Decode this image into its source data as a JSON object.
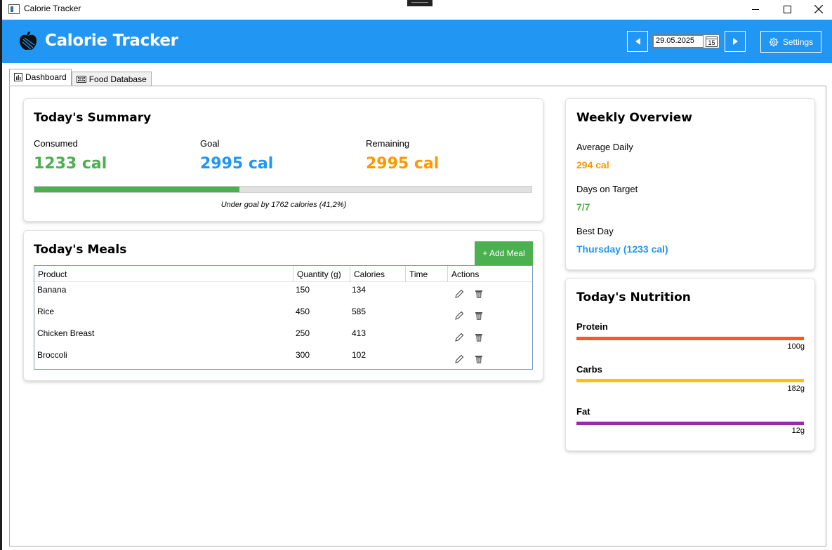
{
  "window": {
    "title": "Calorie Tracker"
  },
  "header": {
    "title": "Calorie Tracker",
    "date": "29.05.2025",
    "calendar_day": "15",
    "settings_label": "Settings",
    "color": "#2196F3"
  },
  "tabs": [
    {
      "label": "Dashboard",
      "icon": "bar-chart-icon",
      "active": true
    },
    {
      "label": "Food Database",
      "icon": "film-database-icon",
      "active": false
    }
  ],
  "summary": {
    "title": "Today's Summary",
    "consumed_label": "Consumed",
    "consumed_value": "1233 cal",
    "goal_label": "Goal",
    "goal_value": "2995 cal",
    "remaining_label": "Remaining",
    "remaining_value": "2995 cal",
    "progress_fraction": 0.412,
    "note": "Under goal by 1762 calories (41,2%)"
  },
  "meals": {
    "title": "Today's Meals",
    "add_label": "+ Add Meal",
    "columns": [
      "Product",
      "Quantity (g)",
      "Calories",
      "Time",
      "Actions"
    ],
    "rows": [
      {
        "product": "Banana",
        "quantity": "150",
        "calories": "134",
        "time": ""
      },
      {
        "product": "Rice",
        "quantity": "450",
        "calories": "585",
        "time": ""
      },
      {
        "product": "Chicken Breast",
        "quantity": "250",
        "calories": "413",
        "time": ""
      },
      {
        "product": "Broccoli",
        "quantity": "300",
        "calories": "102",
        "time": ""
      }
    ]
  },
  "weekly": {
    "title": "Weekly Overview",
    "avg_label": "Average Daily",
    "avg_value": "294 cal",
    "target_label": "Days on Target",
    "target_value": "7/7",
    "best_label": "Best Day",
    "best_value": "Thursday (1233 cal)"
  },
  "nutrition": {
    "title": "Today's Nutrition",
    "items": [
      {
        "label": "Protein",
        "value": "100g",
        "color": "#FF5722"
      },
      {
        "label": "Carbs",
        "value": "182g",
        "color": "#FFC107"
      },
      {
        "label": "Fat",
        "value": "12g",
        "color": "#9C27B0"
      }
    ]
  }
}
